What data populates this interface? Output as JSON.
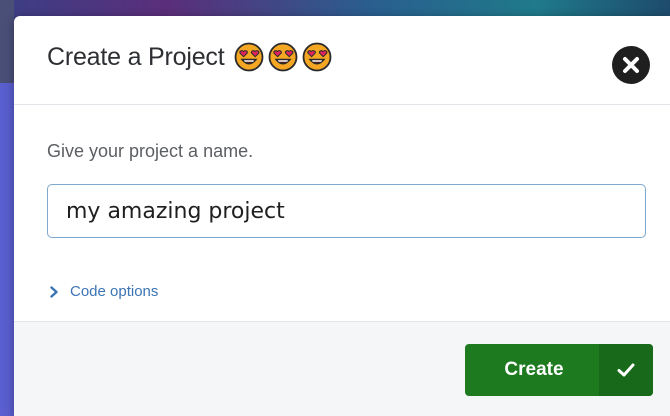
{
  "dialog": {
    "title": "Create a Project",
    "title_emojis": [
      "heart-eyes-emoji",
      "heart-eyes-emoji",
      "heart-eyes-emoji"
    ],
    "close_icon": "close-icon"
  },
  "form": {
    "prompt": "Give your project a name.",
    "project_name_value": "my amazing project",
    "code_options_label": "Code options",
    "code_options_icon": "chevron-right-icon"
  },
  "footer": {
    "create_label": "Create",
    "create_icon": "checkmark-icon"
  },
  "colors": {
    "primary_button": "#1d7a1f",
    "link": "#3c74b3",
    "input_border": "#7ea9cf"
  }
}
